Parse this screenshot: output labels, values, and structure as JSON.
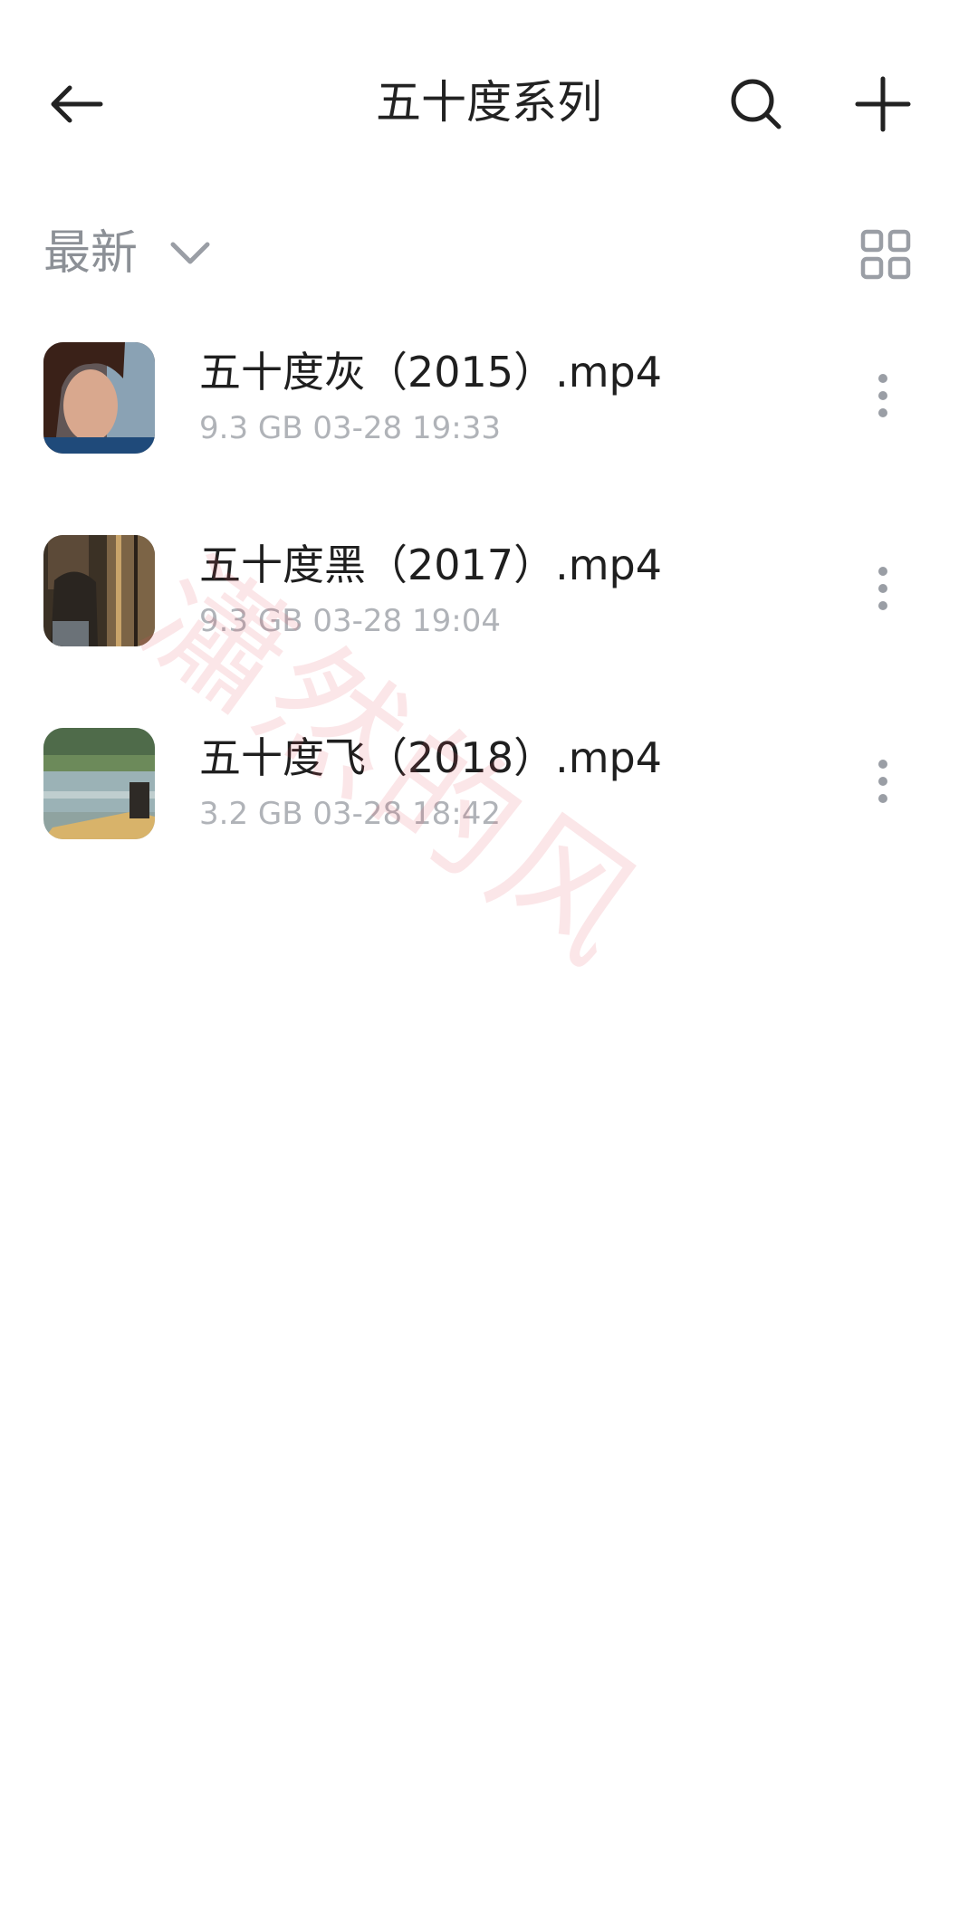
{
  "header": {
    "title": "五十度系列",
    "back_icon": "arrow-left-icon",
    "search_icon": "search-icon",
    "add_icon": "plus-icon"
  },
  "sort": {
    "label": "最新",
    "chevron_icon": "chevron-down-icon",
    "view_icon": "grid-view-icon"
  },
  "files": [
    {
      "name": "五十度灰（2015）.mp4",
      "size": "9.3 GB",
      "date": "03-28 19:33"
    },
    {
      "name": "五十度黑（2017）.mp4",
      "size": "9.3 GB",
      "date": "03-28 19:04"
    },
    {
      "name": "五十度飞（2018）.mp4",
      "size": "3.2 GB",
      "date": "03-28 18:42"
    }
  ],
  "watermark": "瀟然的风",
  "colors": {
    "text_primary": "#1f1f1f",
    "text_secondary": "#b0b3b8",
    "sort_text": "#8c9096",
    "icon_dark": "#222222",
    "icon_gray": "#9a9ea5"
  }
}
